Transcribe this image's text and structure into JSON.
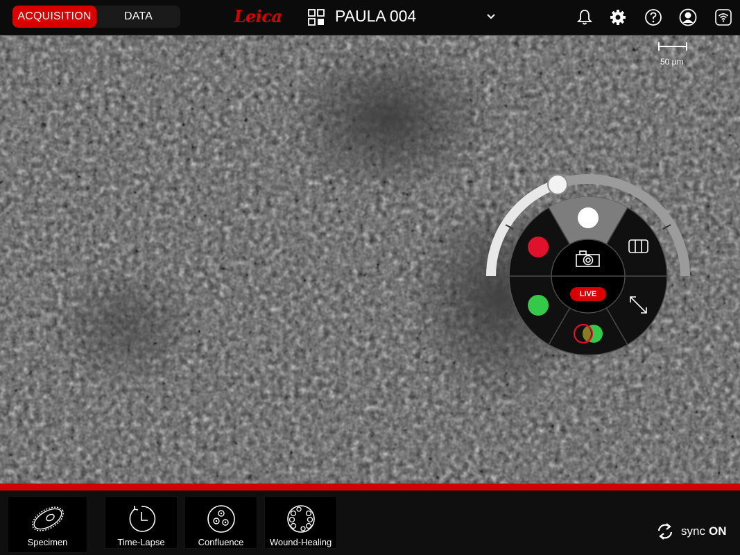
{
  "header": {
    "tabs": [
      {
        "label": "ACQUISITION",
        "active": true
      },
      {
        "label": "DATA",
        "active": false
      }
    ],
    "logo": "Leica",
    "project_title": "PAULA 004",
    "icons": [
      "grid-icon",
      "chevron-down-icon",
      "bell-icon",
      "gear-icon",
      "help-icon",
      "user-icon",
      "wifi-icon"
    ]
  },
  "viewer": {
    "scale_label": "50 µm"
  },
  "radial_menu": {
    "live_label": "LIVE",
    "channels": [
      {
        "name": "brightfield",
        "color": "#ffffff",
        "selected": true
      },
      {
        "name": "red",
        "color": "#e0112b"
      },
      {
        "name": "green",
        "color": "#35c94a"
      },
      {
        "name": "overlay",
        "color": "#35c94a"
      }
    ],
    "icons": [
      "camera-icon",
      "film-icon",
      "expand-icon",
      "overlay-icon"
    ]
  },
  "toolbar": {
    "tools": [
      {
        "label": "Specimen",
        "icon": "specimen-icon"
      },
      {
        "label": "Time-Lapse",
        "icon": "time-lapse-icon"
      },
      {
        "label": "Confluence",
        "icon": "confluence-icon"
      },
      {
        "label": "Wound-Healing",
        "icon": "wound-healing-icon"
      }
    ],
    "sync_label": "sync",
    "sync_state": "ON"
  },
  "colors": {
    "accent": "#d90000",
    "background": "#0b0b0b"
  }
}
